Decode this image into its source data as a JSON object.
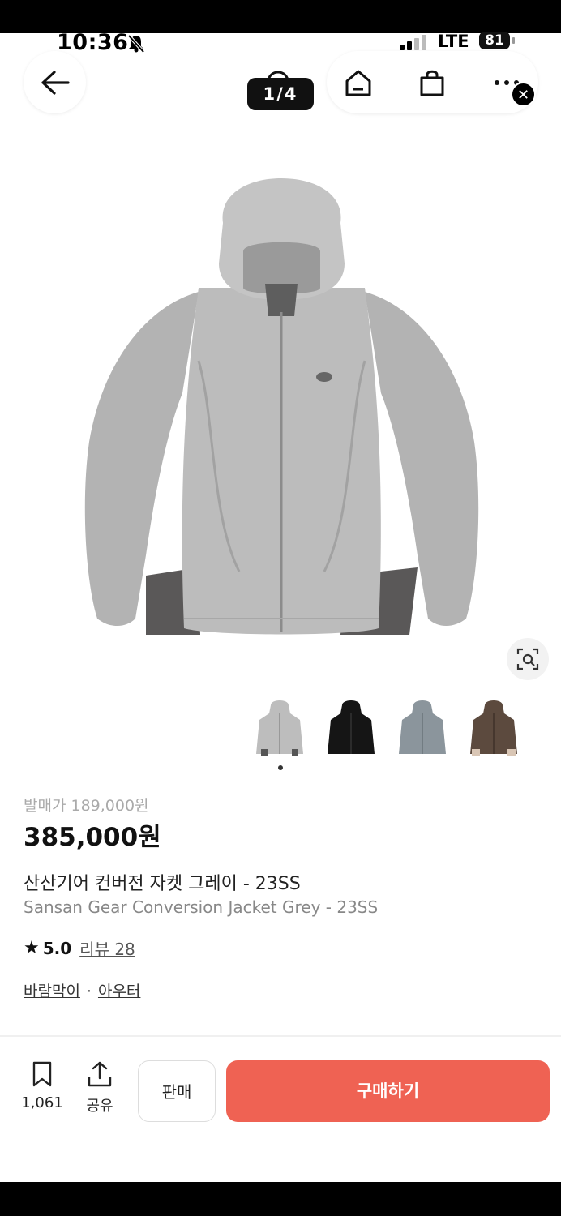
{
  "status_bar": {
    "time": "10:36",
    "network": "LTE",
    "battery": "81"
  },
  "header": {
    "page_indicator": "1/4"
  },
  "product": {
    "release_price": "발매가 189,000원",
    "price": "385,000원",
    "name_ko": "산산기어 컨버전 자켓 그레이 - 23SS",
    "name_en": "Sansan Gear Conversion Jacket Grey - 23SS",
    "rating": "5.0",
    "review_label": "리뷰 28",
    "categories": [
      "바람막이",
      "아우터"
    ],
    "category_separator": "·",
    "colors": [
      "#bdbdbd",
      "#151515",
      "#8b959c",
      "#5c4a3e"
    ]
  },
  "bottom_bar": {
    "wishlist_count": "1,061",
    "share_label": "공유",
    "sell_label": "판매",
    "buy_label": "구매하기"
  },
  "accent_color": "#ef6253"
}
